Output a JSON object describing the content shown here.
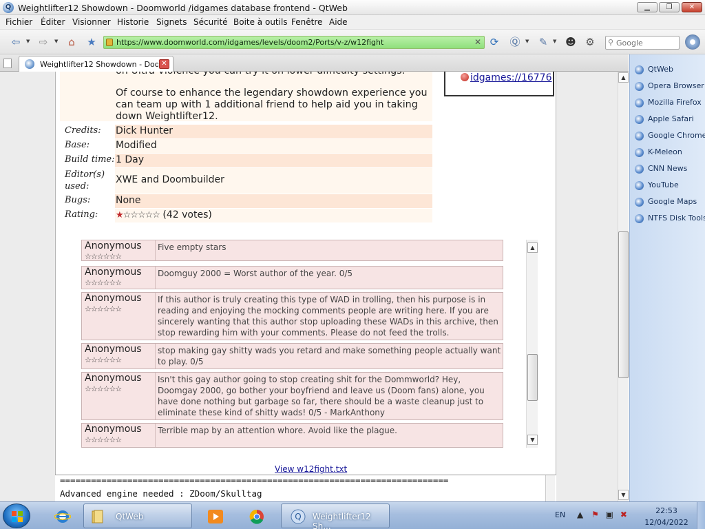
{
  "window": {
    "title": "Weightlifter12 Showdown - Doomworld /idgames database frontend - QtWeb",
    "minimize": "▁",
    "maximize": "❐",
    "close": "✕"
  },
  "menu": [
    "Fichier",
    "Éditer",
    "Visionner",
    "Historie",
    "Signets",
    "Sécurité",
    "Boite à outils",
    "Fenêtre",
    "Aide"
  ],
  "toolbar": {
    "back": "⇦",
    "forward": "⇨",
    "home": "⌂",
    "bookmark": "★",
    "url": "https://www.doomworld.com/idgames/levels/doom2/Ports/v-z/w12fight",
    "url_clear": "✕",
    "reload": "⟳",
    "search_placeholder": "Google"
  },
  "tab": {
    "label": "Weightlifter12 Showdown - Doom...",
    "close": "✕"
  },
  "description": {
    "partial_line": "on Ultra-Violence you can try it on lower difficulty settings.",
    "paragraph": "Of course to enhance the legendary showdown experience you can team up with 1 additional friend to help aid you in taking down Weightlifter12."
  },
  "info": [
    {
      "label": "Credits:",
      "value": "Dick Hunter"
    },
    {
      "label": "Base:",
      "value": "Modified"
    },
    {
      "label": "Build time:",
      "value": "1 Day"
    },
    {
      "label": "Editor(s) used:",
      "value": "XWE and Doombuilder"
    },
    {
      "label": "Bugs:",
      "value": "None"
    },
    {
      "label": "Rating:",
      "value": "(42 votes)",
      "stars_filled": 1,
      "stars_total": 6
    }
  ],
  "idgames_link": "idgames://16776",
  "comments": [
    {
      "author": "Anonymous",
      "rating": "☆☆☆☆☆☆",
      "text": "Five empty stars"
    },
    {
      "author": "Anonymous",
      "rating": "☆☆☆☆☆☆",
      "text": "Doomguy 2000 = Worst author of the year. 0/5"
    },
    {
      "author": "Anonymous",
      "rating": "☆☆☆☆☆☆",
      "text": "If this author is truly creating this type of WAD in trolling, then his purpose is in reading and enjoying the mocking comments people are writing here. If you are sincerely wanting that this author stop uploading these WADs in this archive, then stop rewarding him with your comments. Please do not feed the trolls."
    },
    {
      "author": "Anonymous",
      "rating": "☆☆☆☆☆☆",
      "text": "stop making gay shitty wads you retard and make something people actually want to play. 0/5"
    },
    {
      "author": "Anonymous",
      "rating": "☆☆☆☆☆☆",
      "text": "Isn't this gay author going to stop creating shit for the Dommworld? Hey, Doomgay 2000, go bother your boyfriend and leave us (Doom fans) alone, you have done nothing but garbage so far, there should be a waste cleanup just to eliminate these kind of shitty wads! 0/5 - MarkAnthony"
    },
    {
      "author": "Anonymous",
      "rating": "☆☆☆☆☆☆",
      "text": "Terrible map by an attention whore. Avoid like the plague."
    }
  ],
  "view_txt_link": "View w12fight.txt",
  "txt": {
    "line1": "===========================================================================",
    "line2": "Advanced engine needed  : ZDoom/Skulltag"
  },
  "bookmarks": [
    "QtWeb",
    "Opera Browser",
    "Mozilla Firefox",
    "Apple Safari",
    "Google Chrome",
    "K-Meleon",
    "CNN News",
    "YouTube",
    "Google Maps",
    "NTFS Disk Tools"
  ],
  "taskbar": {
    "items": [
      {
        "label": "QtWeb",
        "icon": "folder-icon"
      },
      {
        "label": "Weightlifter12 Sh...",
        "icon": "qtweb-icon"
      }
    ],
    "language": "EN",
    "time": "22:53",
    "date": "12/04/2022"
  },
  "colors": {
    "url_bar": "#8fe07c",
    "comment_bg": "#f7e4e4",
    "info_odd": "#fde6d6",
    "info_even": "#fff7ee",
    "link": "#1a1a9a",
    "sidebar_bg": "#c9dbf2",
    "taskbar": "#a6bedf"
  }
}
